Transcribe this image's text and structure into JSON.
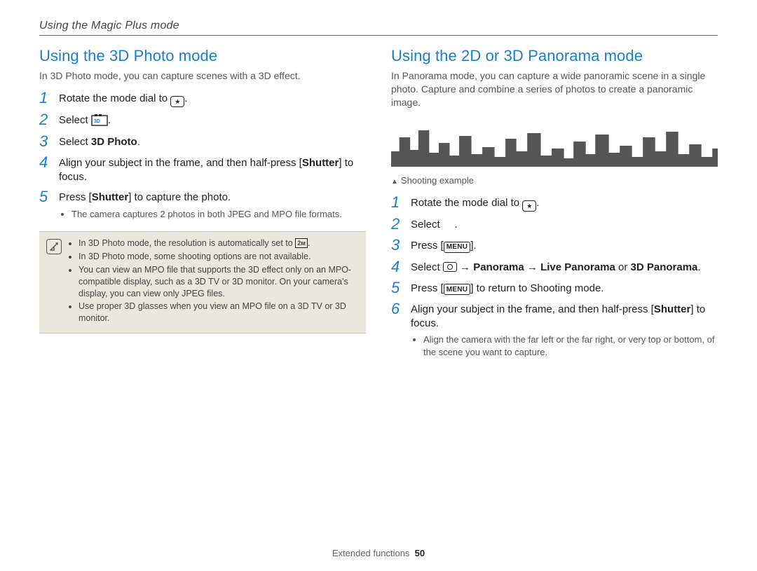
{
  "header": {
    "breadcrumb": "Using the Magic Plus mode"
  },
  "left": {
    "title": "Using the 3D Photo mode",
    "intro": "In 3D Photo mode, you can capture scenes with a 3D effect.",
    "steps": {
      "1": {
        "num": "1",
        "pre": "Rotate the mode dial to "
      },
      "2": {
        "num": "2",
        "pre": "Select "
      },
      "3": {
        "num": "3",
        "pre": "Select ",
        "bold": "3D Photo",
        "post": "."
      },
      "4": {
        "num": "4",
        "pre": "Align your subject in the frame, and then half-press [",
        "bold": "Shutter",
        "post": "] to focus."
      },
      "5": {
        "num": "5",
        "pre": "Press [",
        "bold": "Shutter",
        "post": "] to capture the photo.",
        "sub": "The camera captures 2 photos in both JPEG and MPO file formats."
      }
    },
    "notes": [
      {
        "pre": "In 3D Photo mode, the resolution is automatically set to ",
        "icon": "2m",
        "post": "."
      },
      {
        "text": "In 3D Photo mode, some shooting options are not available."
      },
      {
        "text": "You can view an MPO file that supports the 3D effect only on an MPO-compatible display, such as a 3D TV or 3D monitor. On your camera's display, you can view only JPEG files."
      },
      {
        "text": "Use proper 3D glasses when you view an MPO file on a 3D TV or 3D monitor."
      }
    ]
  },
  "right": {
    "title": "Using the 2D or 3D Panorama mode",
    "intro": "In Panorama mode, you can capture a wide panoramic scene in a single photo. Capture and combine a series of photos to create a panoramic image.",
    "caption": "Shooting example",
    "steps": {
      "1": {
        "num": "1",
        "pre": "Rotate the mode dial to "
      },
      "2": {
        "num": "2",
        "pre": "Select ",
        "post": "."
      },
      "3": {
        "num": "3",
        "pre": "Press [",
        "icon": "menu",
        "post": "]."
      },
      "4": {
        "num": "4",
        "pre": "Select ",
        "icon": "cam",
        "arrow1": " → ",
        "bold1": "Panorama",
        "arrow2": " → ",
        "bold2": "Live Panorama",
        "mid": " or ",
        "bold3": "3D Panorama",
        "post": "."
      },
      "5": {
        "num": "5",
        "pre": "Press [",
        "icon": "menu",
        "post": "] to return to Shooting mode."
      },
      "6": {
        "num": "6",
        "pre": "Align your subject in the frame, and then half-press [",
        "bold": "Shutter",
        "post": "] to focus.",
        "sub": "Align the camera with the far left or the far right, or very top or bottom, of the scene you want to capture."
      }
    }
  },
  "footer": {
    "section": "Extended functions",
    "page": "50"
  }
}
